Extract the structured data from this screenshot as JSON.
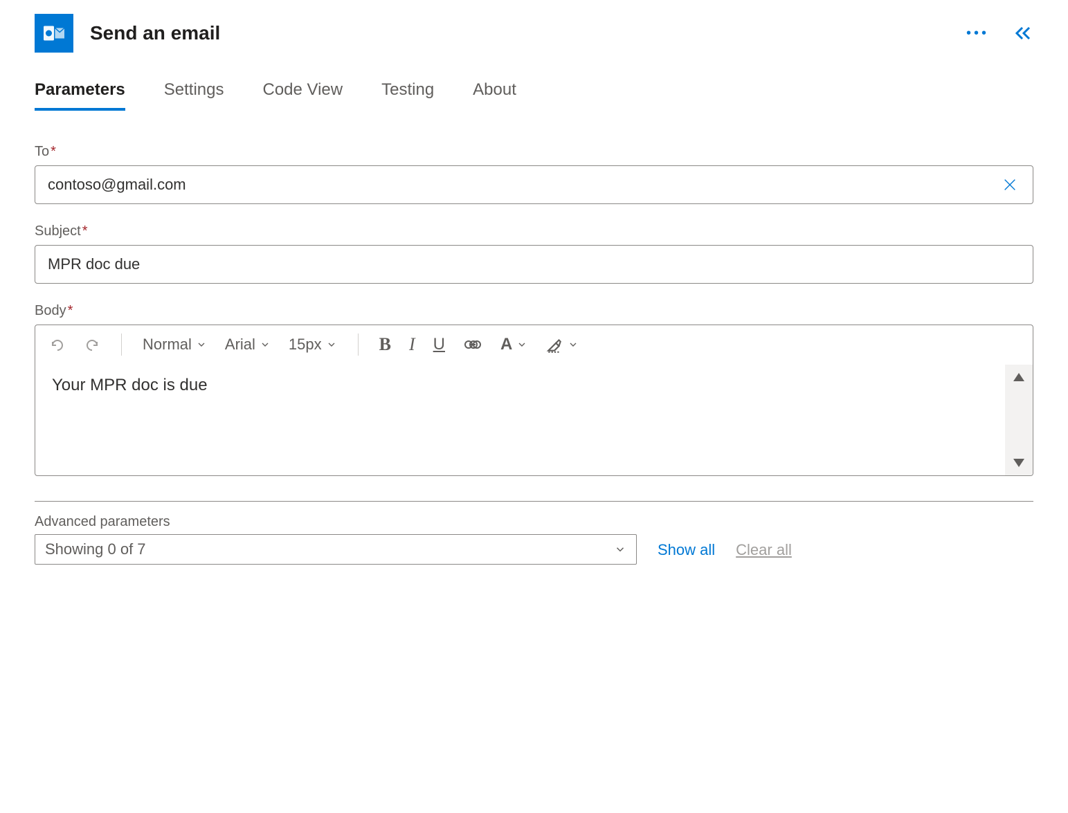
{
  "header": {
    "title": "Send an email"
  },
  "tabs": {
    "items": [
      {
        "label": "Parameters",
        "active": true
      },
      {
        "label": "Settings",
        "active": false
      },
      {
        "label": "Code View",
        "active": false
      },
      {
        "label": "Testing",
        "active": false
      },
      {
        "label": "About",
        "active": false
      }
    ]
  },
  "fields": {
    "to": {
      "label": "To",
      "value": "contoso@gmail.com"
    },
    "subject": {
      "label": "Subject",
      "value": "MPR doc due"
    },
    "body": {
      "label": "Body",
      "content": "Your MPR doc is due"
    }
  },
  "toolbar": {
    "format": "Normal",
    "font": "Arial",
    "size": "15px"
  },
  "advanced": {
    "label": "Advanced parameters",
    "selected": "Showing 0 of 7",
    "show_all": "Show all",
    "clear_all": "Clear all"
  }
}
